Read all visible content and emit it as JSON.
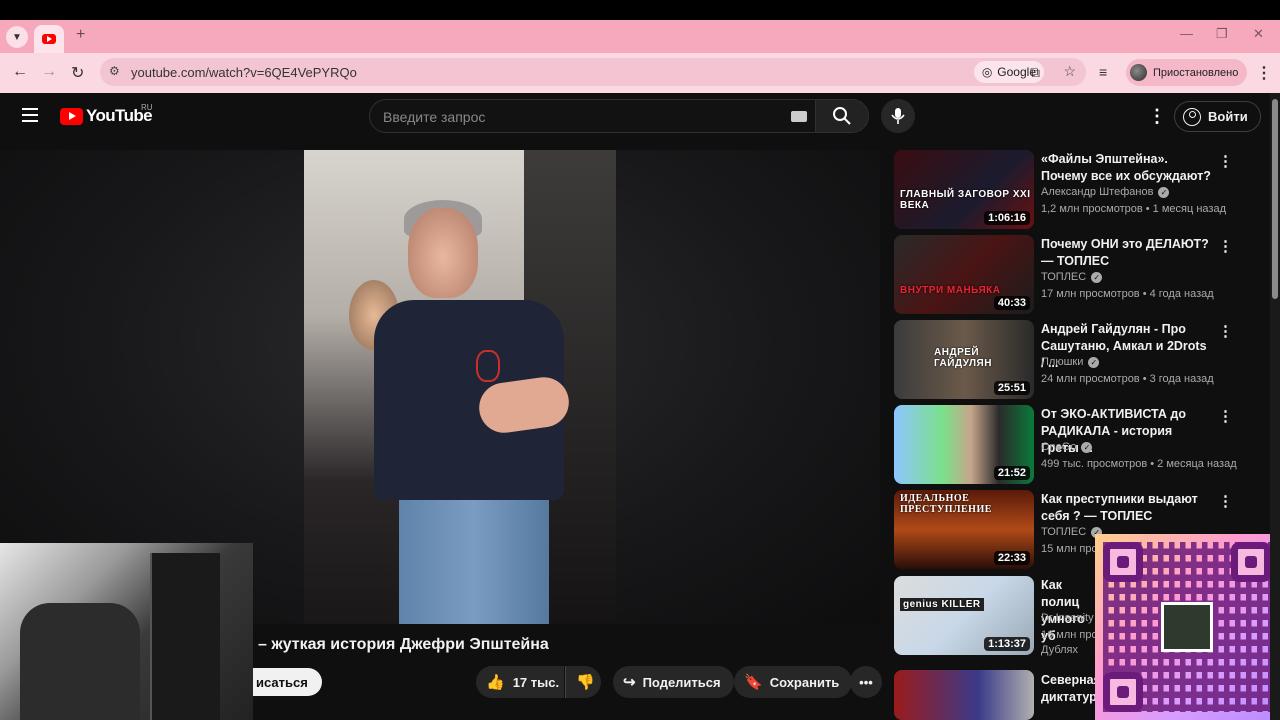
{
  "browser": {
    "url": "youtube.com/watch?v=6QE4VePYRQo",
    "search_chip": "Google",
    "profile_label": "Приостановлено",
    "new_tab": "+"
  },
  "youtube": {
    "logo_text": "YouTube",
    "country": "RU",
    "search_placeholder": "Введите запрос",
    "signin_label": "Войти"
  },
  "video": {
    "title_fragment": "– жуткая история Джефри Эпштейна",
    "subscribe_partial": "исаться",
    "likes": "17 тыс.",
    "share_label": "Поделиться",
    "save_label": "Сохранить"
  },
  "recommendations": [
    {
      "title": "«Файлы Эпштейна». Почему все их обсуждают?",
      "channel": "Александр Штефанов",
      "verified": true,
      "meta": "1,2 млн просмотров • 1 месяц назад",
      "duration": "1:06:16",
      "caption": "ГЛАВНЫЙ ЗАГОВОР XXI ВЕКА"
    },
    {
      "title": "Почему ОНИ это ДЕЛАЮТ? — ТОПЛЕС",
      "channel": "ТОПЛЕС",
      "verified": true,
      "meta": "17 млн просмотров • 4 года назад",
      "duration": "40:33",
      "caption": "ВНУТРИ МАНЬЯКА"
    },
    {
      "title": "Андрей Гайдулян - Про Сашутаню, Амкал и 2Drots / ...",
      "channel": "Плюшки",
      "verified": true,
      "meta": "24 млн просмотров • 3 года назад",
      "duration": "25:51",
      "caption": "АНДРЕЙ ГАЙДУЛЯН"
    },
    {
      "title": "От ЭКО-АКТИВИСТА до РАДИКАЛА - история Греты ...",
      "channel": "OneGo",
      "verified": true,
      "meta": "499 тыс. просмотров • 2 месяца назад",
      "duration": "21:52",
      "caption": ""
    },
    {
      "title": "Как преступники выдают себя ? — ТОПЛЕС",
      "channel": "ТОПЛЕС",
      "verified": true,
      "meta": "15 млн просм",
      "duration": "22:33",
      "caption": "ИДЕАЛЬНОЕ ПРЕСТУПЛЕНИЕ"
    },
    {
      "title": "Как полиц умного уб",
      "channel": "Dr Insanity",
      "verified": false,
      "meta": "16 млн просм",
      "extra": "Дублях",
      "duration": "1:13:37",
      "caption": "genius KILLER"
    },
    {
      "title": "Северная диктатур",
      "channel": "",
      "verified": false,
      "meta": "",
      "duration": "",
      "caption": ""
    }
  ],
  "colors": {
    "tabstrip": "#f6a8bd",
    "toolbar": "#fbd9e3",
    "yt_red": "#ff0000",
    "page_bg": "#0f0f0f"
  }
}
